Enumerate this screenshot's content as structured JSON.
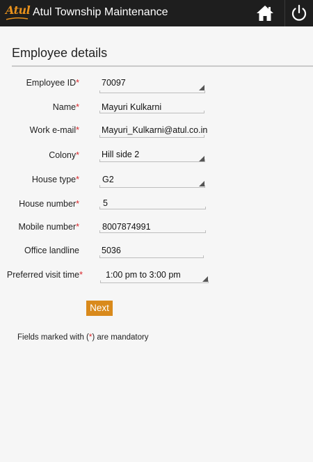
{
  "app": {
    "logo_text": "Atul",
    "title": "Atul Township Maintenance"
  },
  "icons": {
    "home": "home-icon",
    "power": "power-icon"
  },
  "page": {
    "title": "Employee details"
  },
  "form": {
    "required_marker": "*",
    "fields": [
      {
        "label": "Employee ID",
        "value": "70097",
        "required": true,
        "type": "select"
      },
      {
        "label": "Name",
        "value": "Mayuri Kulkarni",
        "required": true,
        "type": "text"
      },
      {
        "label": "Work e-mail",
        "value": "Mayuri_Kulkarni@atul.co.in",
        "required": true,
        "type": "text"
      },
      {
        "label": "Colony",
        "value": "Hill side 2",
        "required": true,
        "type": "select"
      },
      {
        "label": "House type",
        "value": "G2",
        "required": true,
        "type": "select"
      },
      {
        "label": "House number",
        "value": "5",
        "required": true,
        "type": "text"
      },
      {
        "label": "Mobile number",
        "value": "8007874991",
        "required": true,
        "type": "text"
      },
      {
        "label": "Office landline",
        "value": "5036",
        "required": false,
        "type": "text"
      },
      {
        "label": "Preferred visit time",
        "value": "1:00 pm to 3:00 pm",
        "required": true,
        "type": "select"
      }
    ],
    "next_label": "Next"
  },
  "footnote": {
    "before": "Fields marked with (",
    "marker": "*",
    "after": ") are mandatory"
  },
  "colors": {
    "accent": "#d98a1c",
    "required": "#d9262a",
    "topbar": "#1e1e1e"
  }
}
